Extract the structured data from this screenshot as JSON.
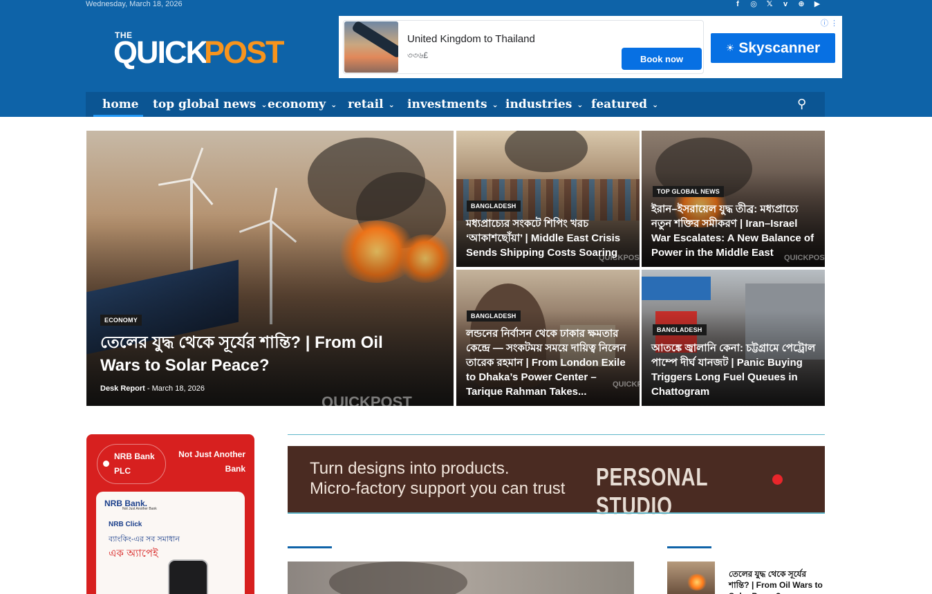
{
  "header": {
    "date": "Wednesday, March 18, 2026",
    "social_icons": [
      "facebook-icon",
      "instagram-icon",
      "x-icon",
      "vimeo-icon",
      "web-icon",
      "youtube-icon"
    ],
    "social_glyphs": [
      "f",
      "◎",
      "𝕏",
      "v",
      "⊕",
      "▶"
    ],
    "logo": {
      "the": "THE",
      "quick": "QUICK",
      "post": "POST"
    }
  },
  "ad_top": {
    "title": "United Kingdom to Thailand",
    "price": "৩৩৬£",
    "cta": "Book now",
    "brand": "Skyscanner",
    "info_icon": "ⓘ ⋮"
  },
  "nav": {
    "items": [
      {
        "label": "home"
      },
      {
        "label": "top global news",
        "chevron": "⌄"
      },
      {
        "label": "economy",
        "chevron": "⌄"
      },
      {
        "label": "retail",
        "chevron": "⌄"
      },
      {
        "label": "investments",
        "chevron": "⌄"
      },
      {
        "label": "industries",
        "chevron": "⌄"
      },
      {
        "label": "featured",
        "chevron": "⌄"
      }
    ],
    "search_glyph": "⚲"
  },
  "featured": {
    "main": {
      "tag": "ECONOMY",
      "title": "তেলের যুদ্ধ থেকে সূর্যের শান্তি? | From Oil Wars to Solar Peace?",
      "author": "Desk Report",
      "separator": "-",
      "date": "March 18, 2026"
    },
    "tiles": [
      {
        "tag": "BANGLADESH",
        "title": "মধ্যপ্রাচ্যের সংকটে শিপিং খরচ ‘আকাশছোঁয়া’ | Middle East Crisis Sends Shipping Costs Soaring"
      },
      {
        "tag": "TOP GLOBAL NEWS",
        "title": "ইরান–ইসরায়েল যুদ্ধ তীব্র: মধ্যপ্রাচ্যে নতুন শক্তির সমীকরণ | Iran–Israel War Escalates: A New Balance of Power in the Middle East"
      },
      {
        "tag": "BANGLADESH",
        "title": "লন্ডনের নির্বাসন থেকে ঢাকার ক্ষমতার কেন্দ্রে — সংকটময় সময়ে দায়িত্ব নিলেন তারেক রহমান | From London Exile to Dhaka’s Power Center – Tarique Rahman Takes..."
      },
      {
        "tag": "BANGLADESH",
        "title": "আতঙ্কে জ্বালানি কেনা: চট্টগ্রামে পেট্রোল পাম্পে দীর্ঘ যানজট | Panic Buying Triggers Long Fuel Queues in Chattogram"
      }
    ],
    "watermark": "QUICKPOST"
  },
  "ad_nrb": {
    "name": "NRB Bank PLC",
    "slogan": "Not Just Another Bank",
    "card_bank": "NRB Bank.",
    "card_sub": "Not Just Another Bank",
    "card_click": "NRB Click",
    "card_line1": "ব্যাংকিং-এর সব সমাধান",
    "card_line2": "এক অ্যাপেই"
  },
  "ad_studio": {
    "line1": "Turn designs into products.",
    "line2": "Micro-factory support you can trust",
    "brand": "PERSONAL STUDIO"
  },
  "sidebar_post": {
    "title": "তেলের যুদ্ধ থেকে সূর্যের শান্তি? | From Oil Wars to Solar Peace?"
  }
}
